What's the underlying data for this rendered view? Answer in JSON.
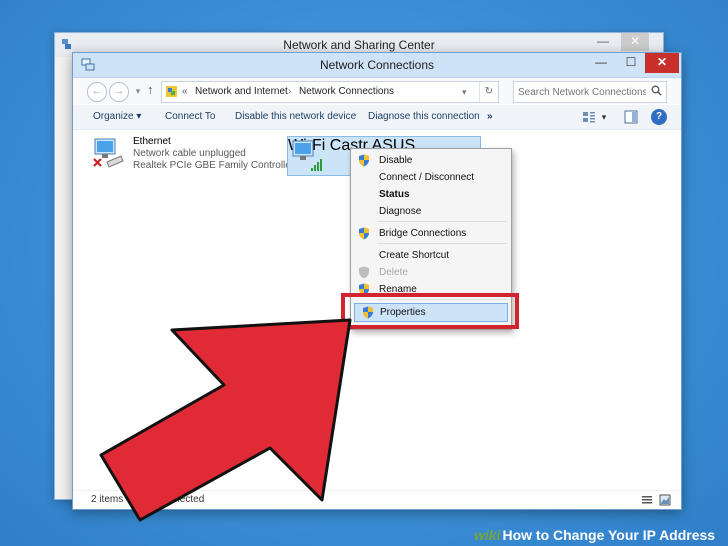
{
  "back_window": {
    "title": "Network and Sharing Center",
    "min": "—",
    "close": "✕"
  },
  "window": {
    "title": "Network Connections",
    "controls": {
      "min": "—",
      "max": "☐",
      "close": "✕"
    }
  },
  "address": {
    "back": "←",
    "forward": "→",
    "up": "↑",
    "chevron": "«",
    "crumbs": [
      "Network and Internet",
      "Network Connections"
    ],
    "crumb_sep": "›",
    "dropdown": "▾",
    "refresh": "↻"
  },
  "search": {
    "placeholder": "Search Network Connections",
    "icon": "search-icon"
  },
  "toolbar": {
    "organize": "Organize ▾",
    "connect_to": "Connect To",
    "disable": "Disable this network device",
    "diagnose": "Diagnose this connection",
    "more": "»",
    "view_arrow": "▾",
    "help": "?"
  },
  "items": {
    "ethernet": {
      "name": "Ethernet",
      "status": "Network cable unplugged",
      "adapter": "Realtek PCIe GBE Family Controller"
    },
    "wifi": {
      "name": "Wi-Fi",
      "status": "Castr",
      "adapter": "ASUS"
    }
  },
  "menu": {
    "disable": "Disable",
    "connect": "Connect / Disconnect",
    "status": "Status",
    "diagnose": "Diagnose",
    "bridge": "Bridge Connections",
    "shortcut": "Create Shortcut",
    "delete": "Delete",
    "rename": "Rename",
    "properties": "Properties"
  },
  "statusbar": {
    "count": "2 items",
    "selected": "1 item selected"
  },
  "watermark": {
    "brand": "wiki",
    "title": "How to Change Your IP Address"
  },
  "colors": {
    "highlight_box": "#d2242c",
    "arrow": "#e02a35",
    "desktop": "#3b8fd6"
  }
}
